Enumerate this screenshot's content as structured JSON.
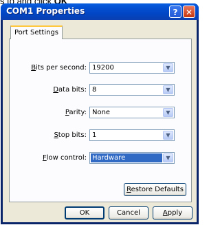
{
  "above_text": {
    "prefix": "s to and click ",
    "bold": "OK"
  },
  "window": {
    "title": "COM1 Properties",
    "help_glyph": "?",
    "close_glyph": "✕"
  },
  "tabs": [
    {
      "label": "Port Settings"
    }
  ],
  "fields": [
    {
      "label_pre": "",
      "label_u": "B",
      "label_post": "its per second:",
      "value": "19200"
    },
    {
      "label_pre": "",
      "label_u": "D",
      "label_post": "ata bits:",
      "value": "8"
    },
    {
      "label_pre": "",
      "label_u": "P",
      "label_post": "arity:",
      "value": "None"
    },
    {
      "label_pre": "",
      "label_u": "S",
      "label_post": "top bits:",
      "value": "1"
    },
    {
      "label_pre": "",
      "label_u": "F",
      "label_post": "low control:",
      "value": "Hardware"
    }
  ],
  "restore_button": {
    "label_u": "R",
    "label_post": "estore Defaults"
  },
  "buttons": {
    "ok": "OK",
    "cancel": "Cancel",
    "apply_u": "A",
    "apply_post": "pply"
  },
  "colors": {
    "titlebar": "#0553d6",
    "face": "#ece9d8",
    "selection": "#316ac5"
  }
}
